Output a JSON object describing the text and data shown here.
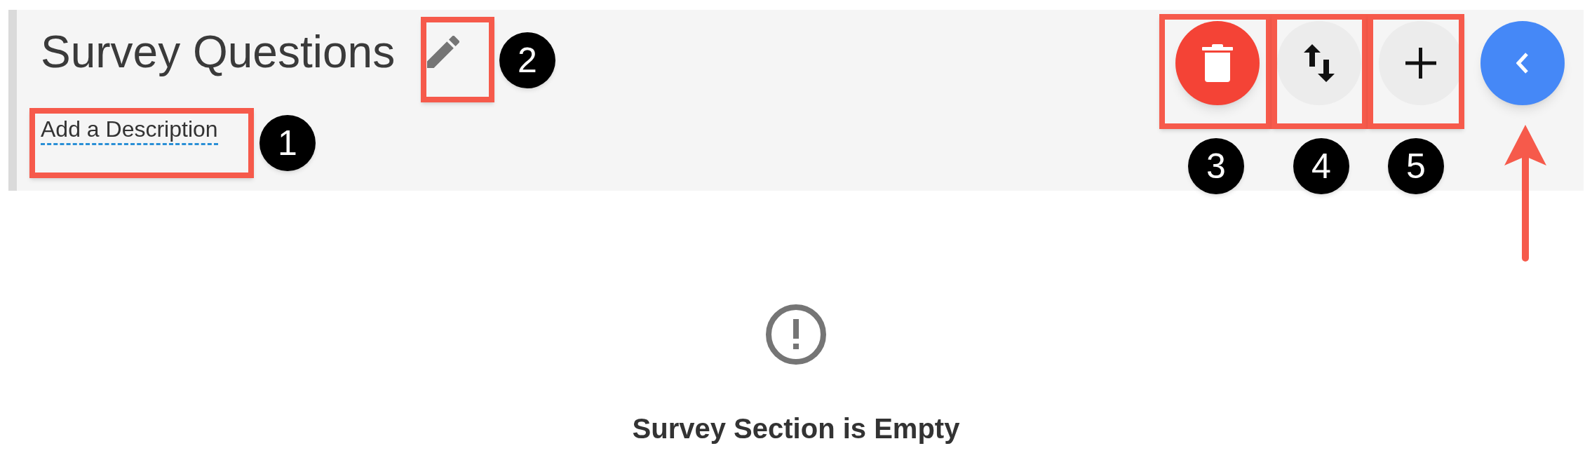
{
  "header": {
    "title": "Survey Questions",
    "description_link": "Add a Description"
  },
  "toolbar": [
    {
      "kind": "delete"
    },
    {
      "kind": "sort"
    },
    {
      "kind": "add"
    },
    {
      "kind": "collapse"
    }
  ],
  "annotations": [
    {
      "label": "1"
    },
    {
      "label": "2"
    },
    {
      "label": "3"
    },
    {
      "label": "4"
    },
    {
      "label": "5"
    }
  ],
  "empty_state": {
    "message": "Survey Section is Empty"
  }
}
